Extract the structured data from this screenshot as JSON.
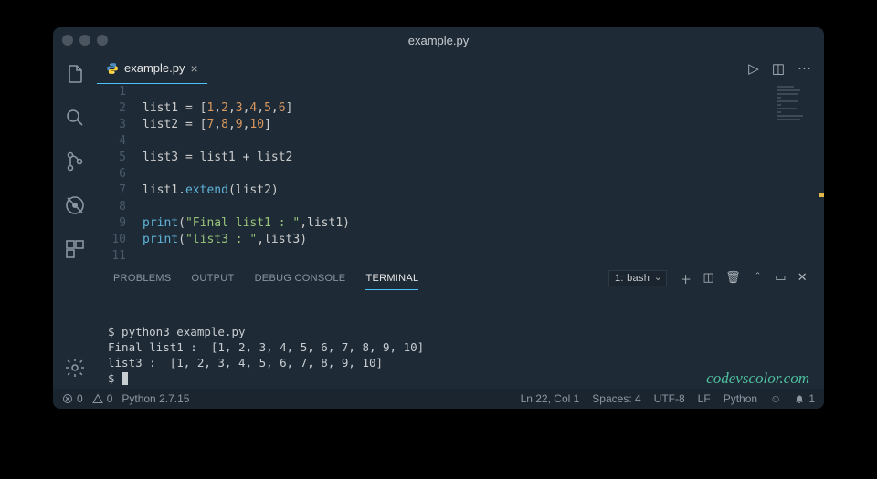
{
  "title": "example.py",
  "tab": {
    "filename": "example.py"
  },
  "actions": {
    "run": "▷",
    "split": "◫",
    "more": "···"
  },
  "code": {
    "lines": [
      "",
      "list1 = [1,2,3,4,5,6]",
      "list2 = [7,8,9,10]",
      "",
      "list3 = list1 + list2",
      "",
      "list1.extend(list2)",
      "",
      "print(\"Final list1 : \",list1)",
      "print(\"list3 : \",list3)",
      ""
    ],
    "start_line": 1
  },
  "panel": {
    "tabs": {
      "problems": "PROBLEMS",
      "output": "OUTPUT",
      "debug": "DEBUG CONSOLE",
      "terminal": "TERMINAL"
    },
    "active": "terminal",
    "shell_label": "1: bash",
    "toolbar": {
      "new": "＋",
      "split": "◫",
      "trash": "🗑",
      "up": "＾",
      "max": "▭",
      "close": "✕"
    }
  },
  "terminal": {
    "lines": [
      "$ python3 example.py",
      "Final list1 :  [1, 2, 3, 4, 5, 6, 7, 8, 9, 10]",
      "list3 :  [1, 2, 3, 4, 5, 6, 7, 8, 9, 10]",
      "$ "
    ]
  },
  "watermark": "codevscolor.com",
  "status": {
    "errors": "0",
    "warnings": "0",
    "python_ver": "Python 2.7.15",
    "cursor": "Ln 22, Col 1",
    "spaces": "Spaces: 4",
    "encoding": "UTF-8",
    "eol": "LF",
    "lang": "Python",
    "bell": "1"
  }
}
